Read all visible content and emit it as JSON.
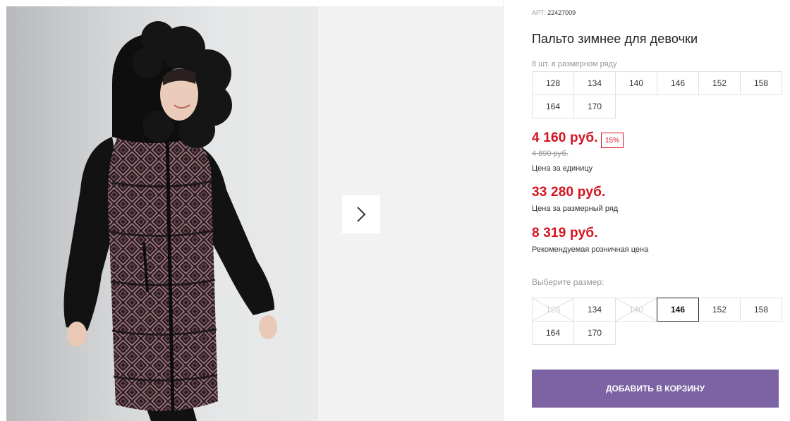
{
  "product": {
    "sku_label": "АРТ:",
    "sku_value": "22427009",
    "title": "Пальто зимнее для девочки",
    "pack_note": "8 шт. в размерном ряду"
  },
  "pack_sizes": [
    "128",
    "134",
    "140",
    "146",
    "152",
    "158",
    "164",
    "170"
  ],
  "prices": {
    "unit_price": "4 160 руб.",
    "discount": "15%",
    "old_price": "4 890 руб.",
    "unit_caption": "Цена за единицу",
    "pack_price": "33 280 руб.",
    "pack_caption": "Цена за размерный ряд",
    "retail_price": "8 319 руб.",
    "retail_caption": "Рекомендуемая розничная цена"
  },
  "size_selector": {
    "label": "Выберите размер:",
    "options": [
      {
        "size": "128",
        "state": "disabled"
      },
      {
        "size": "134",
        "state": "available"
      },
      {
        "size": "140",
        "state": "disabled"
      },
      {
        "size": "146",
        "state": "selected"
      },
      {
        "size": "152",
        "state": "available"
      },
      {
        "size": "158",
        "state": "available"
      },
      {
        "size": "164",
        "state": "available"
      },
      {
        "size": "170",
        "state": "available"
      }
    ]
  },
  "cart": {
    "add_label": "ДОБАВИТЬ В КОРЗИНУ"
  },
  "colors": {
    "price_red": "#d5121e",
    "button_purple": "#7b63a4"
  },
  "icons": {
    "gallery_next": "chevron-right-icon",
    "unavailable_size": "cross-out-icon"
  }
}
